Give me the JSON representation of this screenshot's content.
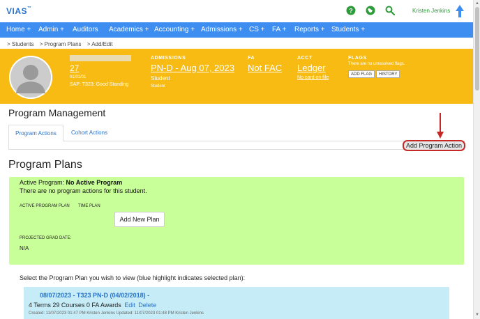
{
  "app": {
    "logo": "VIAS",
    "logo_tm": "™",
    "username": "Kristen Jenkins"
  },
  "nav": [
    {
      "label": "Home +"
    },
    {
      "label": "Admin +"
    },
    {
      "label": "Auditors"
    },
    {
      "label": "Academics +"
    },
    {
      "label": "Accounting +"
    },
    {
      "label": "Admissions +"
    },
    {
      "label": "CS +"
    },
    {
      "label": "FA +"
    },
    {
      "label": "Reports +"
    },
    {
      "label": "Students +"
    }
  ],
  "breadcrumb": [
    "> Students",
    "> Program Plans",
    "> Add/Edit"
  ],
  "student": {
    "id": "27",
    "dob": "01/01/01",
    "sap": "SAP: T323: Good Standing"
  },
  "admissions": {
    "label": "ADMISSIONS",
    "link": "PN-D - Aug 07, 2023",
    "sub": "Student",
    "small": "Student"
  },
  "fa": {
    "label": "FA",
    "link": "Not FAC"
  },
  "acct": {
    "label": "ACCT",
    "link": "Ledger",
    "small_link": "No card on file"
  },
  "flags": {
    "label": "FLAGS",
    "note": "There are no unresolved flags.",
    "add_flag": "ADD FLAG",
    "history": "HISTORY"
  },
  "page": {
    "title": "Program Management"
  },
  "tabs": {
    "program_actions": "Program Actions",
    "cohort_actions": "Cohort Actions"
  },
  "add_program_action": "Add Program Action",
  "plans": {
    "title": "Program Plans",
    "active_program_label": "Active Program: ",
    "active_program_value": "No Active Program",
    "no_actions": "There are no program actions for this student.",
    "col_active": "ACTIVE PROGRAM PLAN",
    "col_time": "TIME PLAN",
    "add_new_plan": "Add New Plan",
    "grad_label": "PROJECTED GRAD DATE:",
    "grad_value": "N/A",
    "select_prompt": "Select the Program Plan you wish to view (blue highlight indicates selected plan):",
    "card": {
      "title": "08/07/2023 - T323 PN-D (04/02/2018) -",
      "info": "4 Terms 29 Courses 0 FA Awards",
      "edit": "Edit",
      "delete": "Delete",
      "meta": "Created: 11/07/2023 01:47 PM Kristen Jenkins    Updated: 11/07/2023 01:48 PM Kristen Jenkins"
    }
  },
  "colors": {
    "nav": "#3d8ef0",
    "banner": "#f7bb13",
    "plan_box": "#c9ff99",
    "plan_card": "#c5ecf7",
    "annotation": "#c62828",
    "user_green": "#2e9b3a"
  }
}
